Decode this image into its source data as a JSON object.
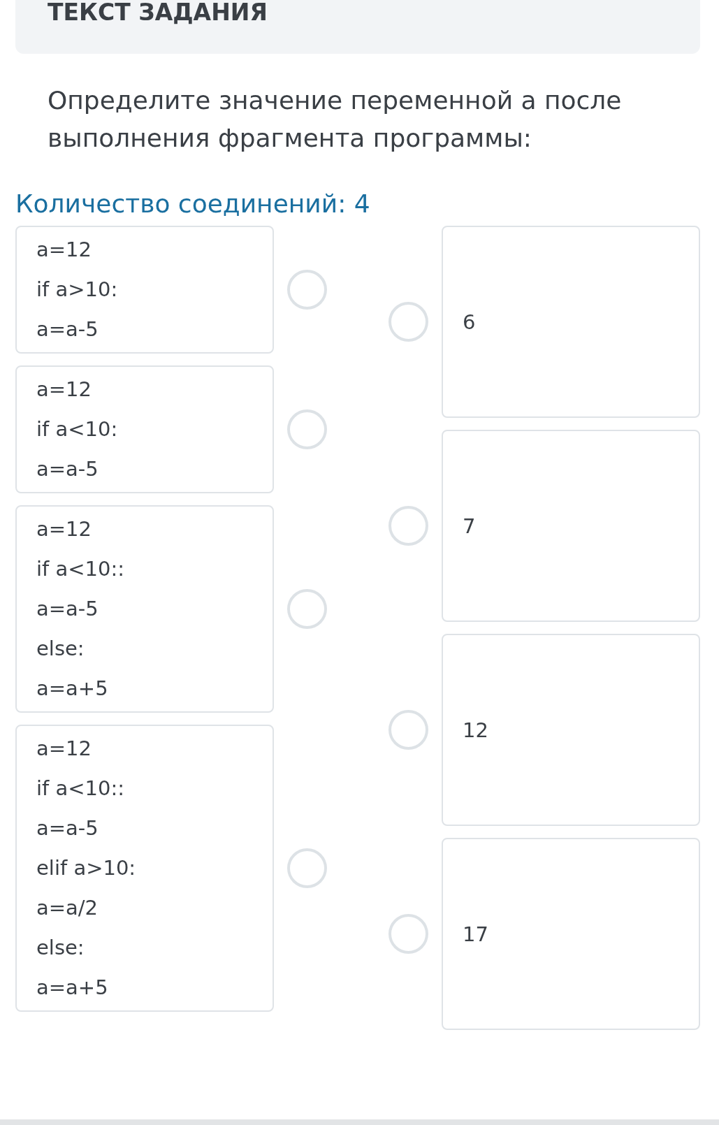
{
  "header": {
    "title": "ТЕКСТ ЗАДАНИЯ"
  },
  "question": "Определите значение переменной а после выполнения фрагмента программы:",
  "connections_label": "Количество соединений: 4",
  "left_items": [
    {
      "lines": [
        "a=12",
        "if a>10:",
        "a=a-5"
      ]
    },
    {
      "lines": [
        "a=12",
        "if a<10:",
        "a=a-5"
      ]
    },
    {
      "lines": [
        "a=12",
        "if a<10::",
        "a=a-5",
        "else:",
        "a=a+5"
      ]
    },
    {
      "lines": [
        "a=12",
        "if a<10::",
        "a=a-5",
        "elif a>10:",
        "a=a/2",
        "else:",
        "a=a+5"
      ]
    }
  ],
  "right_items": [
    {
      "text": "6"
    },
    {
      "text": "7"
    },
    {
      "text": "12"
    },
    {
      "text": "17"
    }
  ]
}
